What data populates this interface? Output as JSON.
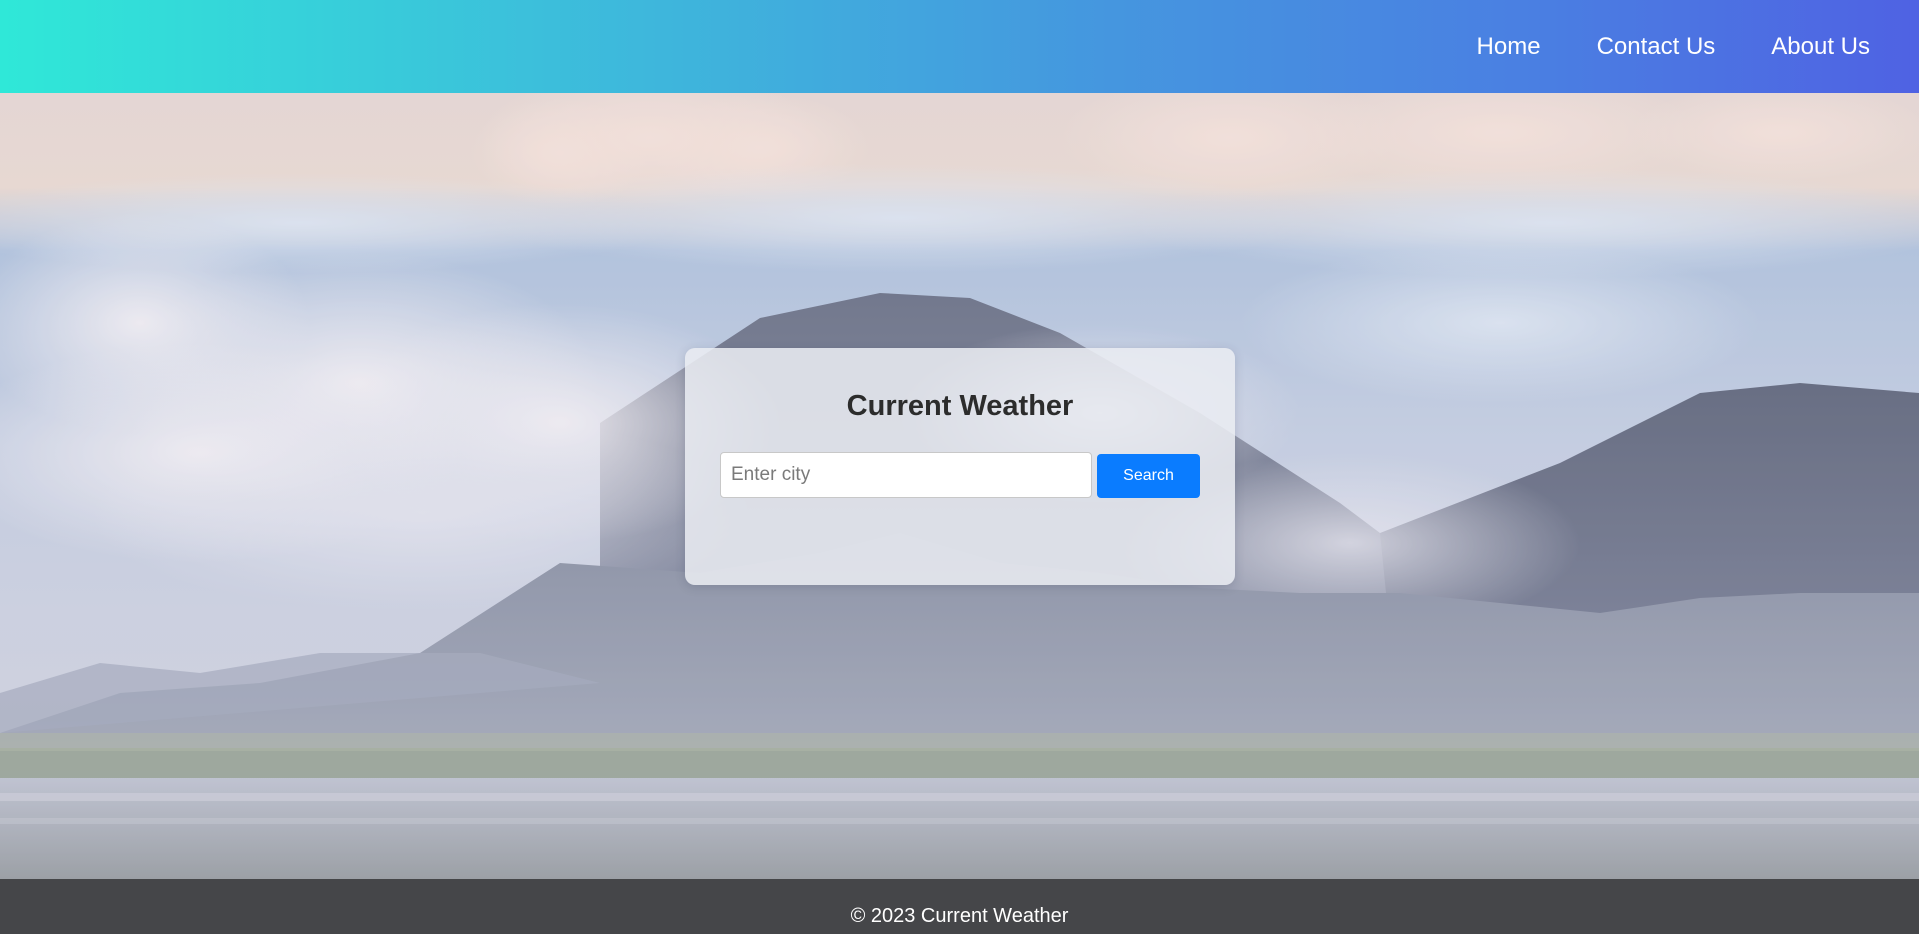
{
  "nav": {
    "items": [
      {
        "label": "Home"
      },
      {
        "label": "Contact Us"
      },
      {
        "label": "About Us"
      }
    ]
  },
  "card": {
    "title": "Current Weather",
    "input_placeholder": "Enter city",
    "input_value": "",
    "search_label": "Search"
  },
  "footer": {
    "text": "© 2023 Current Weather"
  },
  "background": {
    "image": "mountain-clouds-lake-landscape",
    "colors": {
      "header_gradient_start": "#2fe8d8",
      "header_gradient_end": "#4f62e3",
      "button": "#0a7cff",
      "footer": "#3c3c3e"
    }
  }
}
